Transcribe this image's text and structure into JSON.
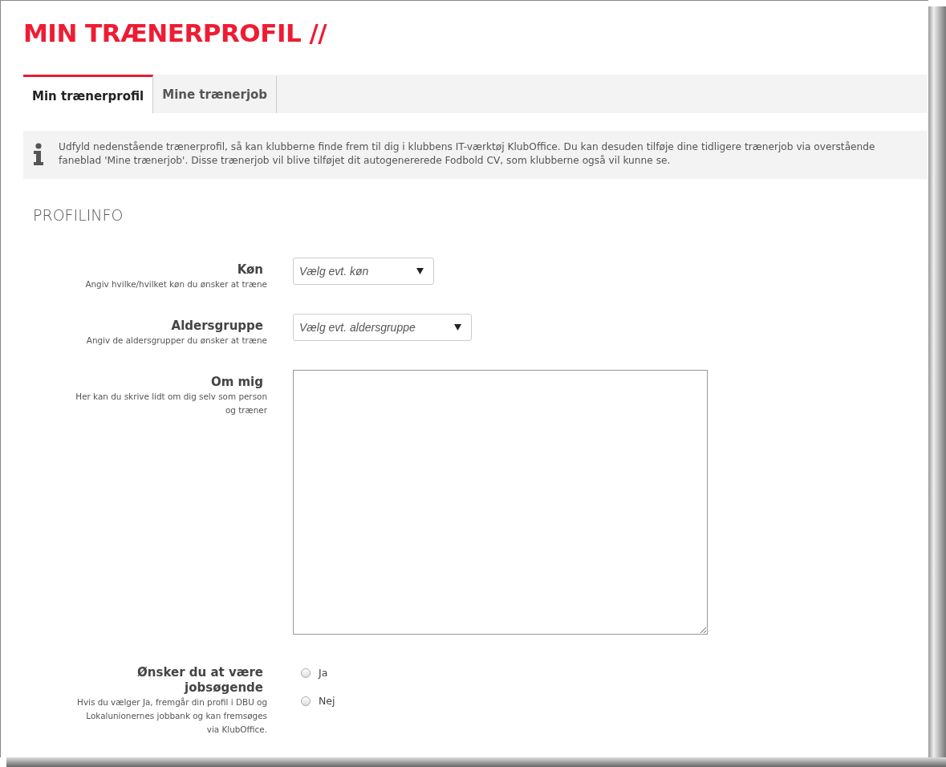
{
  "page": {
    "title": "MIN TRÆNERPROFIL //"
  },
  "tabs": [
    {
      "label": "Min trænerprofil",
      "selected": true
    },
    {
      "label": "Mine trænerjob",
      "selected": false
    }
  ],
  "info": {
    "text": "Udfyld nedenstående trænerprofil, så kan klubberne finde frem til dig i klubbens IT-værktøj KlubOffice. Du kan desuden tilføje dine tidligere trænerjob via overstående faneblad 'Mine trænerjob'. Disse trænerjob vil blive tilføjet dit autogenererede Fodbold CV, som klubberne også vil kunne se."
  },
  "section": {
    "heading": "PROFILINFO"
  },
  "fields": [
    {
      "kind": "select",
      "label": "Køn",
      "help": "Angiv hvilke/hvilket køn du ønsker at træne",
      "placeholder": "Vælg evt. køn"
    },
    {
      "kind": "select",
      "label": "Aldersgruppe",
      "help": "Angiv de aldersgrupper du ønsker at træne",
      "placeholder": "Vælg evt. aldersgruppe"
    },
    {
      "kind": "textarea",
      "label": "Om mig",
      "help": "Her kan du skrive lidt om dig selv som person og træner"
    },
    {
      "kind": "radio",
      "label": "Ønsker du at være jobsøgende",
      "help": "Hvis du vælger Ja, fremgår din profil i DBU og Lokalunionernes jobbank og kan fremsøges via KlubOffice.",
      "options": [
        {
          "label": "Ja",
          "selected": false
        },
        {
          "label": "Nej",
          "selected": false
        }
      ]
    }
  ]
}
